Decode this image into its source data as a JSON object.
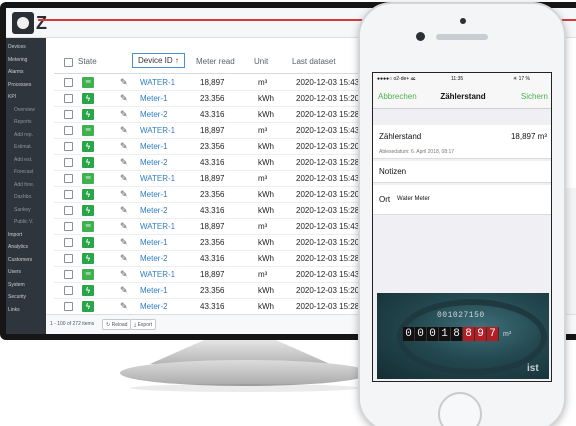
{
  "app": {
    "logo_letter": "Z"
  },
  "sidebar": {
    "items": [
      {
        "label": "Devices",
        "sub": false
      },
      {
        "label": "Metering",
        "sub": false
      },
      {
        "label": "Alarms",
        "sub": false
      },
      {
        "label": "Processes",
        "sub": false
      },
      {
        "label": "KPI",
        "sub": false
      },
      {
        "label": "Overview",
        "sub": true
      },
      {
        "label": "Reports",
        "sub": true
      },
      {
        "label": "Add rep.",
        "sub": true
      },
      {
        "label": "Estimat.",
        "sub": true
      },
      {
        "label": "Add est.",
        "sub": true
      },
      {
        "label": "Forecast",
        "sub": true
      },
      {
        "label": "Add fore.",
        "sub": true
      },
      {
        "label": "Dashbo.",
        "sub": true
      },
      {
        "label": "Sankey",
        "sub": true
      },
      {
        "label": "Public V.",
        "sub": true
      },
      {
        "label": "Import",
        "sub": false
      },
      {
        "label": "Analytics",
        "sub": false
      },
      {
        "label": "Customers",
        "sub": false
      },
      {
        "label": "Users",
        "sub": false
      },
      {
        "label": "System",
        "sub": false
      },
      {
        "label": "Security",
        "sub": false
      },
      {
        "label": "Links",
        "sub": false
      }
    ]
  },
  "grid": {
    "headers": {
      "state": "State",
      "device_id": "Device ID ↑",
      "meter_read": "Meter read",
      "unit": "Unit",
      "last_dataset": "Last dataset"
    },
    "rows": [
      {
        "state": "water",
        "device": "WATER-1",
        "read": "18,897",
        "unit": "m³",
        "last": "2020-12-03 15:43:07"
      },
      {
        "state": "power",
        "device": "Meter-1",
        "read": "23.356",
        "unit": "kWh",
        "last": "2020-12-03 15:20:07"
      },
      {
        "state": "power",
        "device": "Meter-2",
        "read": "43.316",
        "unit": "kWh",
        "last": "2020-12-03 15:28:06"
      },
      {
        "state": "water",
        "device": "WATER-1",
        "read": "18,897",
        "unit": "m³",
        "last": "2020-12-03 15:43:07"
      },
      {
        "state": "power",
        "device": "Meter-1",
        "read": "23.356",
        "unit": "kWh",
        "last": "2020-12-03 15:20:07"
      },
      {
        "state": "power",
        "device": "Meter-2",
        "read": "43.316",
        "unit": "kWh",
        "last": "2020-12-03 15:28:06"
      },
      {
        "state": "water",
        "device": "WATER-1",
        "read": "18,897",
        "unit": "m³",
        "last": "2020-12-03 15:43:07"
      },
      {
        "state": "power",
        "device": "Meter-1",
        "read": "23.356",
        "unit": "kWh",
        "last": "2020-12-03 15:20:07"
      },
      {
        "state": "power",
        "device": "Meter-2",
        "read": "43.316",
        "unit": "kWh",
        "last": "2020-12-03 15:28:06"
      },
      {
        "state": "water",
        "device": "WATER-1",
        "read": "18,897",
        "unit": "m³",
        "last": "2020-12-03 15:43:07"
      },
      {
        "state": "power",
        "device": "Meter-1",
        "read": "23.356",
        "unit": "kWh",
        "last": "2020-12-03 15:20:07"
      },
      {
        "state": "power",
        "device": "Meter-2",
        "read": "43.316",
        "unit": "kWh",
        "last": "2020-12-03 15:28:06"
      },
      {
        "state": "water",
        "device": "WATER-1",
        "read": "18,897",
        "unit": "m³",
        "last": "2020-12-03 15:43:07"
      },
      {
        "state": "power",
        "device": "Meter-1",
        "read": "23.356",
        "unit": "kWh",
        "last": "2020-12-03 15:20:07"
      },
      {
        "state": "power",
        "device": "Meter-2",
        "read": "43.316",
        "unit": "kWh",
        "last": "2020-12-03 15:28:06"
      }
    ]
  },
  "footer": {
    "count": "1 - 100 of 272 items",
    "reload": "↻ Reload",
    "export": "⤓ Export"
  },
  "phone": {
    "status_carrier": "●●●●○ o2-de+ ⪣",
    "status_time": "11:35",
    "status_battery": "✳ 17 %",
    "nav_cancel": "Abbrechen",
    "nav_title": "Zählerstand",
    "nav_save": "Sichern",
    "reading_label": "Zählerstand",
    "reading_value": "18,897 m³",
    "reading_date": "Ablesedatum: 6. April 2018, 08:17",
    "notes_label": "Notizen",
    "location_label": "Ort",
    "location_value": "Water Meter",
    "photo_serial": "001027150",
    "photo_digits": [
      "0",
      "0",
      "0",
      "1",
      "8",
      "8",
      "9",
      "7"
    ],
    "photo_unit": "m³",
    "photo_brand": "ist"
  },
  "colors": {
    "accent_green": "#4cb050",
    "link_blue": "#2e7bc4",
    "brand_red": "#d63b3b"
  }
}
